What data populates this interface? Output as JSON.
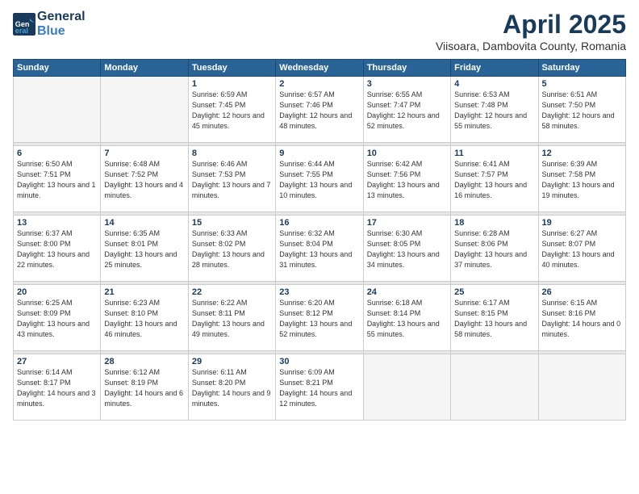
{
  "logo": {
    "line1": "General",
    "line2": "Blue"
  },
  "title": "April 2025",
  "subtitle": "Viisoara, Dambovita County, Romania",
  "weekdays": [
    "Sunday",
    "Monday",
    "Tuesday",
    "Wednesday",
    "Thursday",
    "Friday",
    "Saturday"
  ],
  "weeks": [
    [
      {
        "day": "",
        "sunrise": "",
        "sunset": "",
        "daylight": ""
      },
      {
        "day": "",
        "sunrise": "",
        "sunset": "",
        "daylight": ""
      },
      {
        "day": "1",
        "sunrise": "Sunrise: 6:59 AM",
        "sunset": "Sunset: 7:45 PM",
        "daylight": "Daylight: 12 hours and 45 minutes."
      },
      {
        "day": "2",
        "sunrise": "Sunrise: 6:57 AM",
        "sunset": "Sunset: 7:46 PM",
        "daylight": "Daylight: 12 hours and 48 minutes."
      },
      {
        "day": "3",
        "sunrise": "Sunrise: 6:55 AM",
        "sunset": "Sunset: 7:47 PM",
        "daylight": "Daylight: 12 hours and 52 minutes."
      },
      {
        "day": "4",
        "sunrise": "Sunrise: 6:53 AM",
        "sunset": "Sunset: 7:48 PM",
        "daylight": "Daylight: 12 hours and 55 minutes."
      },
      {
        "day": "5",
        "sunrise": "Sunrise: 6:51 AM",
        "sunset": "Sunset: 7:50 PM",
        "daylight": "Daylight: 12 hours and 58 minutes."
      }
    ],
    [
      {
        "day": "6",
        "sunrise": "Sunrise: 6:50 AM",
        "sunset": "Sunset: 7:51 PM",
        "daylight": "Daylight: 13 hours and 1 minute."
      },
      {
        "day": "7",
        "sunrise": "Sunrise: 6:48 AM",
        "sunset": "Sunset: 7:52 PM",
        "daylight": "Daylight: 13 hours and 4 minutes."
      },
      {
        "day": "8",
        "sunrise": "Sunrise: 6:46 AM",
        "sunset": "Sunset: 7:53 PM",
        "daylight": "Daylight: 13 hours and 7 minutes."
      },
      {
        "day": "9",
        "sunrise": "Sunrise: 6:44 AM",
        "sunset": "Sunset: 7:55 PM",
        "daylight": "Daylight: 13 hours and 10 minutes."
      },
      {
        "day": "10",
        "sunrise": "Sunrise: 6:42 AM",
        "sunset": "Sunset: 7:56 PM",
        "daylight": "Daylight: 13 hours and 13 minutes."
      },
      {
        "day": "11",
        "sunrise": "Sunrise: 6:41 AM",
        "sunset": "Sunset: 7:57 PM",
        "daylight": "Daylight: 13 hours and 16 minutes."
      },
      {
        "day": "12",
        "sunrise": "Sunrise: 6:39 AM",
        "sunset": "Sunset: 7:58 PM",
        "daylight": "Daylight: 13 hours and 19 minutes."
      }
    ],
    [
      {
        "day": "13",
        "sunrise": "Sunrise: 6:37 AM",
        "sunset": "Sunset: 8:00 PM",
        "daylight": "Daylight: 13 hours and 22 minutes."
      },
      {
        "day": "14",
        "sunrise": "Sunrise: 6:35 AM",
        "sunset": "Sunset: 8:01 PM",
        "daylight": "Daylight: 13 hours and 25 minutes."
      },
      {
        "day": "15",
        "sunrise": "Sunrise: 6:33 AM",
        "sunset": "Sunset: 8:02 PM",
        "daylight": "Daylight: 13 hours and 28 minutes."
      },
      {
        "day": "16",
        "sunrise": "Sunrise: 6:32 AM",
        "sunset": "Sunset: 8:04 PM",
        "daylight": "Daylight: 13 hours and 31 minutes."
      },
      {
        "day": "17",
        "sunrise": "Sunrise: 6:30 AM",
        "sunset": "Sunset: 8:05 PM",
        "daylight": "Daylight: 13 hours and 34 minutes."
      },
      {
        "day": "18",
        "sunrise": "Sunrise: 6:28 AM",
        "sunset": "Sunset: 8:06 PM",
        "daylight": "Daylight: 13 hours and 37 minutes."
      },
      {
        "day": "19",
        "sunrise": "Sunrise: 6:27 AM",
        "sunset": "Sunset: 8:07 PM",
        "daylight": "Daylight: 13 hours and 40 minutes."
      }
    ],
    [
      {
        "day": "20",
        "sunrise": "Sunrise: 6:25 AM",
        "sunset": "Sunset: 8:09 PM",
        "daylight": "Daylight: 13 hours and 43 minutes."
      },
      {
        "day": "21",
        "sunrise": "Sunrise: 6:23 AM",
        "sunset": "Sunset: 8:10 PM",
        "daylight": "Daylight: 13 hours and 46 minutes."
      },
      {
        "day": "22",
        "sunrise": "Sunrise: 6:22 AM",
        "sunset": "Sunset: 8:11 PM",
        "daylight": "Daylight: 13 hours and 49 minutes."
      },
      {
        "day": "23",
        "sunrise": "Sunrise: 6:20 AM",
        "sunset": "Sunset: 8:12 PM",
        "daylight": "Daylight: 13 hours and 52 minutes."
      },
      {
        "day": "24",
        "sunrise": "Sunrise: 6:18 AM",
        "sunset": "Sunset: 8:14 PM",
        "daylight": "Daylight: 13 hours and 55 minutes."
      },
      {
        "day": "25",
        "sunrise": "Sunrise: 6:17 AM",
        "sunset": "Sunset: 8:15 PM",
        "daylight": "Daylight: 13 hours and 58 minutes."
      },
      {
        "day": "26",
        "sunrise": "Sunrise: 6:15 AM",
        "sunset": "Sunset: 8:16 PM",
        "daylight": "Daylight: 14 hours and 0 minutes."
      }
    ],
    [
      {
        "day": "27",
        "sunrise": "Sunrise: 6:14 AM",
        "sunset": "Sunset: 8:17 PM",
        "daylight": "Daylight: 14 hours and 3 minutes."
      },
      {
        "day": "28",
        "sunrise": "Sunrise: 6:12 AM",
        "sunset": "Sunset: 8:19 PM",
        "daylight": "Daylight: 14 hours and 6 minutes."
      },
      {
        "day": "29",
        "sunrise": "Sunrise: 6:11 AM",
        "sunset": "Sunset: 8:20 PM",
        "daylight": "Daylight: 14 hours and 9 minutes."
      },
      {
        "day": "30",
        "sunrise": "Sunrise: 6:09 AM",
        "sunset": "Sunset: 8:21 PM",
        "daylight": "Daylight: 14 hours and 12 minutes."
      },
      {
        "day": "",
        "sunrise": "",
        "sunset": "",
        "daylight": ""
      },
      {
        "day": "",
        "sunrise": "",
        "sunset": "",
        "daylight": ""
      },
      {
        "day": "",
        "sunrise": "",
        "sunset": "",
        "daylight": ""
      }
    ]
  ]
}
